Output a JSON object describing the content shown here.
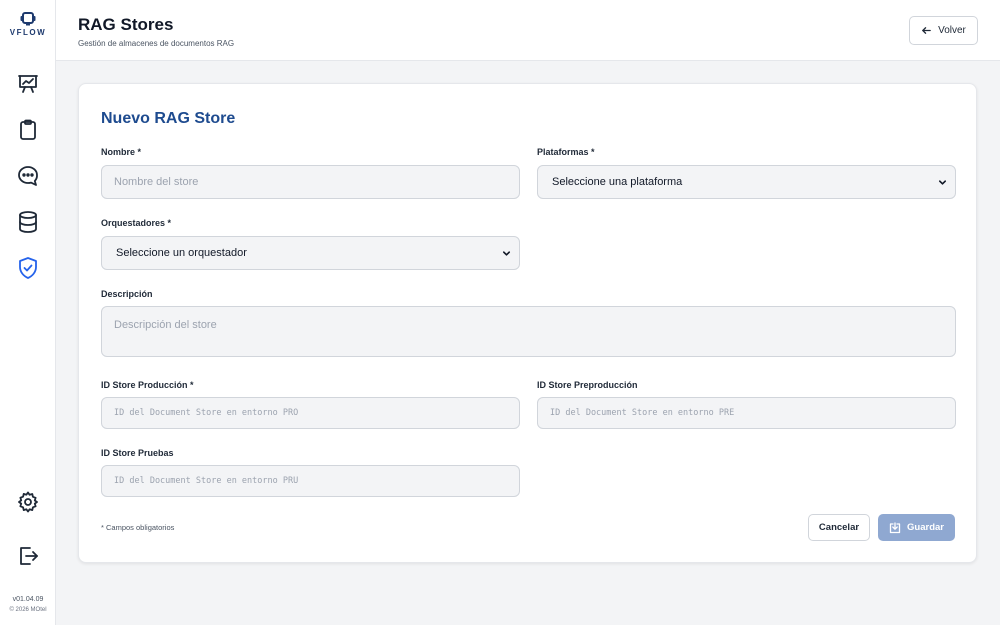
{
  "sidebar": {
    "logo_text": "VFLOW",
    "items": [
      {
        "name": "dashboard",
        "icon": "presentation-chart-icon"
      },
      {
        "name": "clipboard",
        "icon": "clipboard-icon"
      },
      {
        "name": "chat",
        "icon": "chat-bubble-icon"
      },
      {
        "name": "database",
        "icon": "database-icon"
      },
      {
        "name": "security",
        "icon": "shield-check-icon",
        "active": true
      }
    ],
    "settings_icon": "gear-icon",
    "logout_icon": "logout-icon",
    "version": "v01.04.09",
    "copyright": "© 2026 MOtel"
  },
  "header": {
    "title": "RAG Stores",
    "subtitle": "Gestión de almacenes de documentos RAG",
    "back_label": "Volver"
  },
  "form": {
    "title": "Nuevo RAG Store",
    "nombre": {
      "label": "Nombre *",
      "placeholder": "Nombre del store"
    },
    "plataformas": {
      "label": "Plataformas *",
      "value": "Seleccione una plataforma"
    },
    "orquestadores": {
      "label": "Orquestadores *",
      "value": "Seleccione un orquestador"
    },
    "descripcion": {
      "label": "Descripción",
      "placeholder": "Descripción del store"
    },
    "id_produccion": {
      "label": "ID Store Producción *",
      "placeholder": "ID del Document Store en entorno PRO"
    },
    "id_preproduccion": {
      "label": "ID Store Preproducción",
      "placeholder": "ID del Document Store en entorno PRE"
    },
    "id_pruebas": {
      "label": "ID Store Pruebas",
      "placeholder": "ID del Document Store en entorno PRU"
    },
    "required_note": "* Campos obligatorios",
    "cancel_label": "Cancelar",
    "save_label": "Guardar"
  },
  "colors": {
    "accent": "#1e4b8f",
    "active_icon": "#2563eb",
    "save_button": "#8fa8d1"
  }
}
